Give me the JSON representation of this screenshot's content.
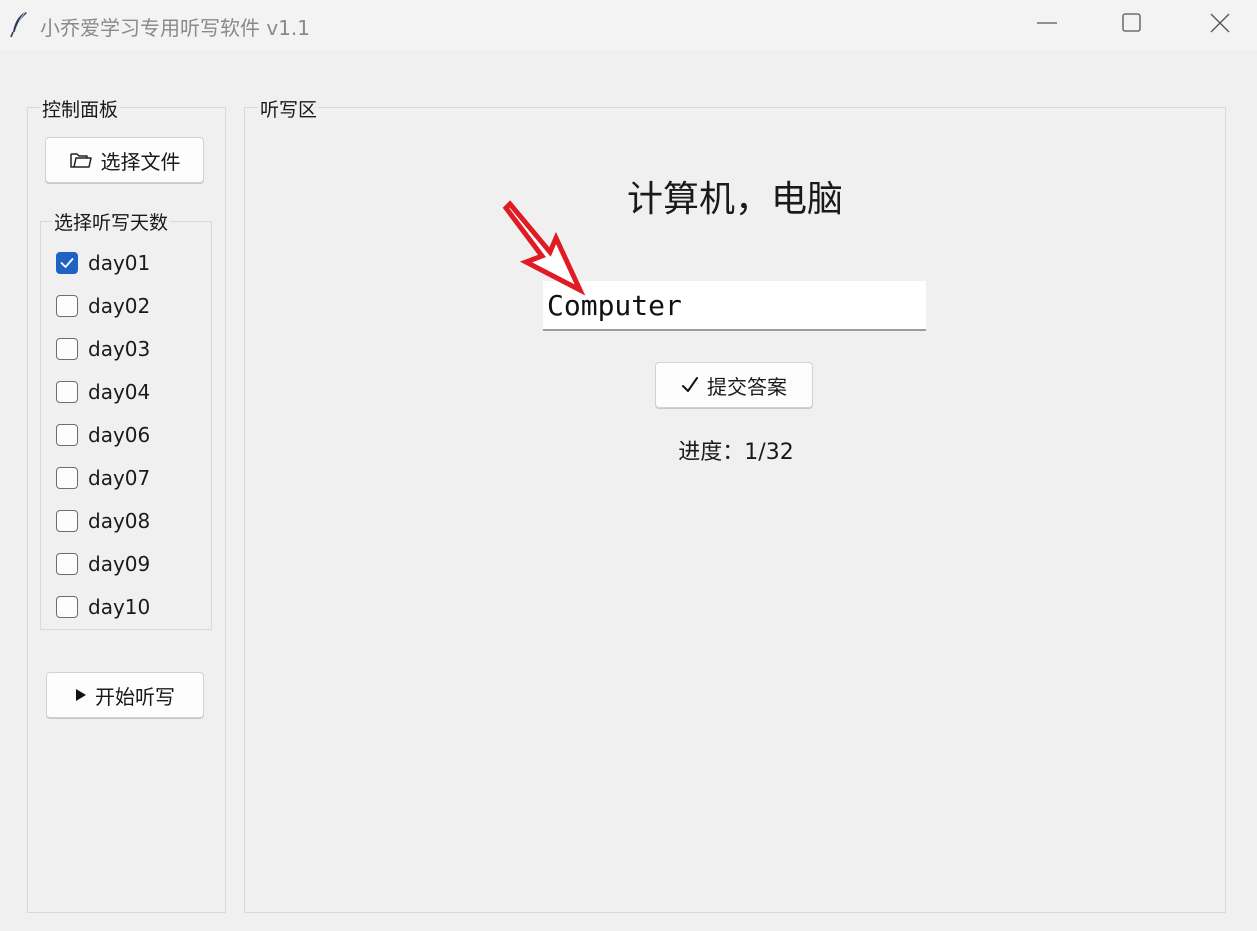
{
  "window": {
    "title": "小乔爱学习专用听写软件 v1.1",
    "controls": [
      "minimize-icon",
      "maximize-icon",
      "close-icon"
    ]
  },
  "control_panel": {
    "title": "控制面板",
    "select_file_label": "选择文件",
    "day_group_title": "选择听写天数",
    "days": [
      {
        "label": "day01",
        "checked": true
      },
      {
        "label": "day02",
        "checked": false
      },
      {
        "label": "day03",
        "checked": false
      },
      {
        "label": "day04",
        "checked": false
      },
      {
        "label": "day06",
        "checked": false
      },
      {
        "label": "day07",
        "checked": false
      },
      {
        "label": "day08",
        "checked": false
      },
      {
        "label": "day09",
        "checked": false
      },
      {
        "label": "day10",
        "checked": false
      }
    ],
    "start_label": "开始听写"
  },
  "dictation": {
    "title": "听写区",
    "prompt": "计算机，电脑",
    "answer_value": "Computer",
    "submit_label": "提交答案",
    "progress_text": "进度：1/32"
  },
  "colors": {
    "background": "#f0f0f0",
    "accent": "#1f62c4",
    "annotation_arrow": "#e01b24"
  }
}
